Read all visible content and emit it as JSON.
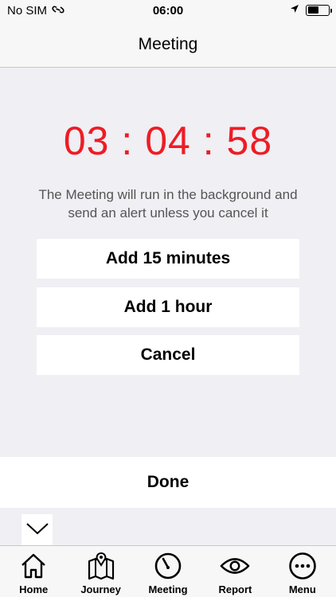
{
  "status": {
    "carrier": "No SIM",
    "time": "06:00",
    "battery_level": 0.55
  },
  "nav": {
    "title": "Meeting"
  },
  "timer": {
    "hours": "03",
    "minutes": "04",
    "seconds": "58",
    "separator": ":",
    "color": "#ee1c24"
  },
  "message": {
    "line1": "The Meeting will run in the background and",
    "line2": "send an alert unless you cancel it"
  },
  "actions": {
    "add15": "Add 15 minutes",
    "add_hour": "Add 1 hour",
    "cancel": "Cancel"
  },
  "done_label": "Done",
  "tabs": [
    {
      "label": "Home",
      "icon": "home-icon"
    },
    {
      "label": "Journey",
      "icon": "map-icon"
    },
    {
      "label": "Meeting",
      "icon": "timer-icon"
    },
    {
      "label": "Report",
      "icon": "eye-icon"
    },
    {
      "label": "Menu",
      "icon": "more-icon"
    }
  ]
}
